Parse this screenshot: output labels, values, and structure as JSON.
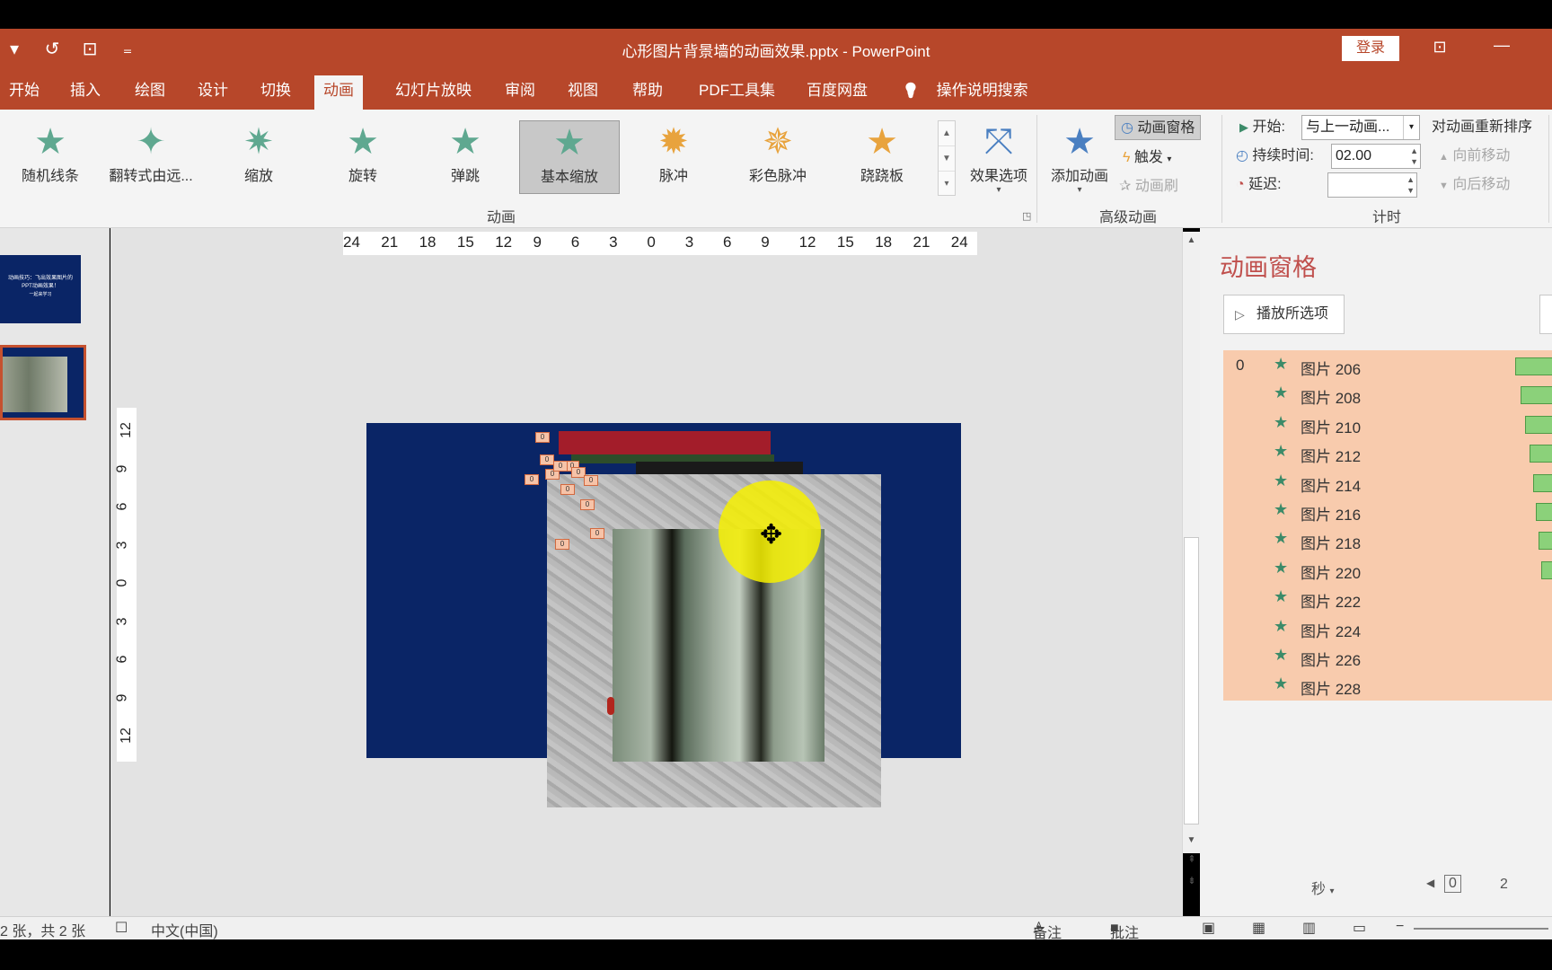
{
  "titlebar": {
    "qat_icons": [
      "dropdown-icon",
      "redo-icon",
      "present-icon",
      "customize-icon"
    ],
    "qat_glyphs": [
      "▾",
      "↺",
      "⊡",
      "₌"
    ],
    "doc_title": "心形图片背景墙的动画效果.pptx  -  PowerPoint",
    "login_label": "登录",
    "restore_glyph": "⊡",
    "minimize_glyph": "—",
    "brand_color": "#b7472a"
  },
  "tabs": [
    {
      "label": "开始"
    },
    {
      "label": "插入"
    },
    {
      "label": "绘图"
    },
    {
      "label": "设计"
    },
    {
      "label": "切换"
    },
    {
      "label": "动画",
      "active": true
    },
    {
      "label": "幻灯片放映"
    },
    {
      "label": "审阅"
    },
    {
      "label": "视图"
    },
    {
      "label": "帮助"
    },
    {
      "label": "PDF工具集"
    },
    {
      "label": "百度网盘"
    }
  ],
  "tell_me": {
    "icon": "lightbulb-icon",
    "glyph": "💡",
    "label": "操作说明搜索"
  },
  "animations": {
    "items": [
      {
        "label": "随机线条",
        "color": "#5fa890",
        "glyph": "★"
      },
      {
        "label": "翻转式由远...",
        "color": "#5fa890",
        "glyph": "✦"
      },
      {
        "label": "缩放",
        "color": "#5fa890",
        "glyph": "✷"
      },
      {
        "label": "旋转",
        "color": "#5fa890",
        "glyph": "★"
      },
      {
        "label": "弹跳",
        "color": "#5fa890",
        "glyph": "★"
      },
      {
        "label": "基本缩放",
        "color": "#5fa890",
        "glyph": "★",
        "selected": true
      },
      {
        "label": "脉冲",
        "color": "#e8a33d",
        "glyph": "✹"
      },
      {
        "label": "彩色脉冲",
        "color": "#e8a33d",
        "glyph": "✵"
      },
      {
        "label": "跷跷板",
        "color": "#e8a33d",
        "glyph": "★"
      }
    ],
    "effect_options_label": "效果选项",
    "group_label": "动画"
  },
  "advanced": {
    "add_animation_label": "添加动画",
    "animation_pane_label": "动画窗格",
    "trigger_label": "触发",
    "painter_label": "动画刷",
    "group_label": "高级动画"
  },
  "timing": {
    "start_label": "开始:",
    "start_value": "与上一动画...",
    "duration_label": "持续时间:",
    "duration_value": "02.00",
    "delay_label": "延迟:",
    "delay_value": "",
    "reorder_label": "对动画重新排序",
    "move_earlier_label": "向前移动",
    "move_later_label": "向后移动",
    "group_label": "计时"
  },
  "ruler": {
    "horizontal": [
      "24",
      "21",
      "18",
      "15",
      "12",
      "9",
      "6",
      "3",
      "0",
      "3",
      "6",
      "9",
      "12",
      "15",
      "18",
      "21",
      "24"
    ],
    "vertical": [
      "12",
      "9",
      "6",
      "3",
      "0",
      "3",
      "6",
      "9",
      "12"
    ]
  },
  "thumbnail": {
    "text_lines": [
      "动画技巧：飞出效果图片的",
      "PPT动画效果！",
      "一起来学习"
    ]
  },
  "slide_tags": [
    "0",
    "0",
    "0",
    "0",
    "0",
    "0",
    "0",
    "0",
    "0",
    "0",
    "0",
    "0"
  ],
  "pane": {
    "title": "动画窗格",
    "play_label": "播放所选项",
    "rows": [
      {
        "num": "0",
        "name": "图片 206",
        "bar_start": 0.63,
        "bar_width": 0.37
      },
      {
        "num": "",
        "name": "图片 208",
        "bar_start": 0.68,
        "bar_width": 0.32
      },
      {
        "num": "",
        "name": "图片 210",
        "bar_start": 0.73,
        "bar_width": 0.27
      },
      {
        "num": "",
        "name": "图片 212",
        "bar_start": 0.77,
        "bar_width": 0.23
      },
      {
        "num": "",
        "name": "图片 214",
        "bar_start": 0.81,
        "bar_width": 0.19
      },
      {
        "num": "",
        "name": "图片 216",
        "bar_start": 0.84,
        "bar_width": 0.16
      },
      {
        "num": "",
        "name": "图片 218",
        "bar_start": 0.86,
        "bar_width": 0.14
      },
      {
        "num": "",
        "name": "图片 220",
        "bar_start": 0.89,
        "bar_width": 0.11
      },
      {
        "num": "",
        "name": "图片 222"
      },
      {
        "num": "",
        "name": "图片 224"
      },
      {
        "num": "",
        "name": "图片 226"
      },
      {
        "num": "",
        "name": "图片 228"
      }
    ],
    "seconds_label": "秒",
    "timeline_start": "0",
    "timeline_mark": "2"
  },
  "status": {
    "slide_count": "2 张，共 2 张",
    "language": "中文(中国)",
    "notes_label": "备注",
    "comments_label": "批注"
  }
}
